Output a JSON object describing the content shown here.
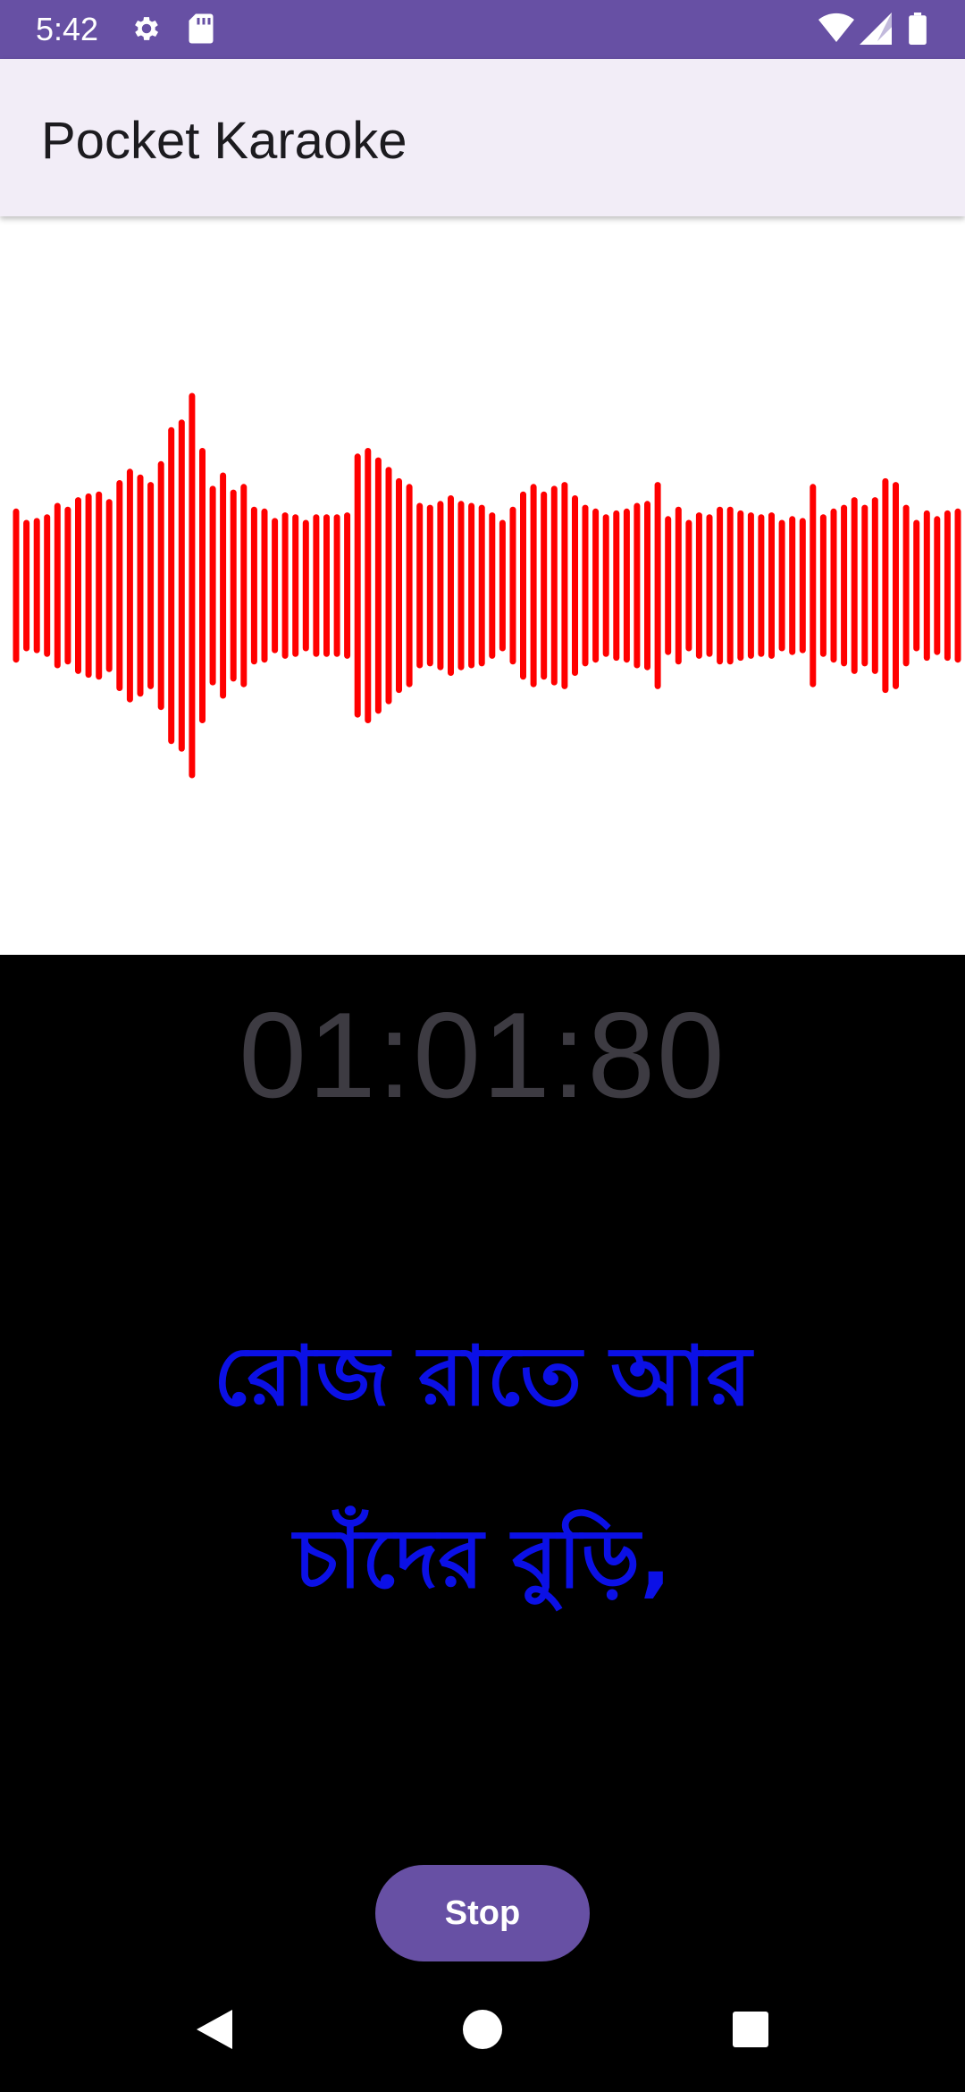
{
  "status_bar": {
    "time": "5:42",
    "icons": [
      "settings-gear-icon",
      "sd-card-icon",
      "wifi-icon",
      "cell-signal-icon",
      "battery-icon"
    ]
  },
  "app_bar": {
    "title": "Pocket Karaoke"
  },
  "waveform": {
    "color": "#ff0000",
    "amplitudes": [
      0.39,
      0.33,
      0.34,
      0.36,
      0.42,
      0.4,
      0.45,
      0.47,
      0.48,
      0.44,
      0.54,
      0.6,
      0.57,
      0.53,
      0.64,
      0.82,
      0.86,
      1.0,
      0.71,
      0.51,
      0.58,
      0.49,
      0.52,
      0.4,
      0.39,
      0.34,
      0.37,
      0.36,
      0.33,
      0.36,
      0.36,
      0.36,
      0.37,
      0.68,
      0.71,
      0.66,
      0.61,
      0.55,
      0.52,
      0.42,
      0.41,
      0.43,
      0.46,
      0.43,
      0.42,
      0.41,
      0.37,
      0.33,
      0.4,
      0.48,
      0.52,
      0.48,
      0.51,
      0.53,
      0.46,
      0.41,
      0.39,
      0.36,
      0.38,
      0.39,
      0.42,
      0.43,
      0.53,
      0.35,
      0.4,
      0.33,
      0.37,
      0.36,
      0.4,
      0.4,
      0.38,
      0.37,
      0.36,
      0.37,
      0.33,
      0.35,
      0.34,
      0.52,
      0.36,
      0.39,
      0.41,
      0.45,
      0.41,
      0.45,
      0.55,
      0.53,
      0.41,
      0.33,
      0.38,
      0.35,
      0.38,
      0.39
    ]
  },
  "player": {
    "timer": "01:01:80",
    "lyric_line_1": "রোজ রাতে আর",
    "lyric_line_2": "চাঁদের বুড়ি,",
    "lyric_color": "#0b10e6",
    "stop_label": "Stop"
  },
  "colors": {
    "primary": "#6750a4",
    "appbar_bg": "#f2edf7",
    "wave": "#ff0000"
  },
  "nav_bar": {
    "icons": [
      "back-icon",
      "home-icon",
      "recents-icon"
    ]
  }
}
